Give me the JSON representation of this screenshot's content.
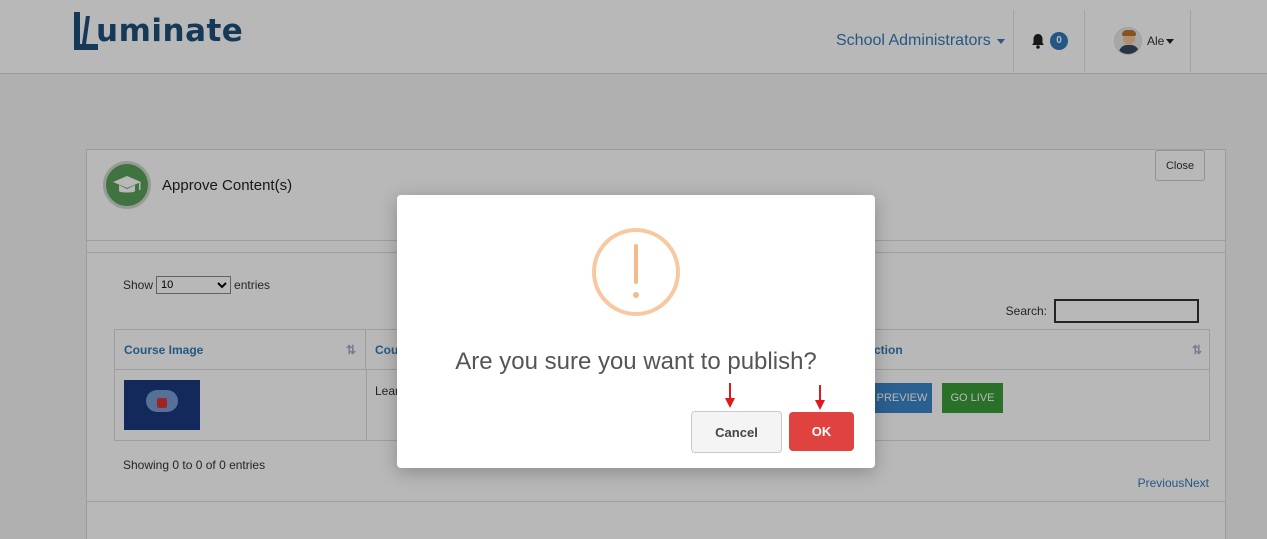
{
  "header": {
    "logo_text": "uminate",
    "role_menu_label": "School Administrators",
    "notification_count": "0",
    "user_name": "Ale"
  },
  "panel": {
    "title": "Approve Content(s)",
    "close_label": "Close",
    "show_label": "Show",
    "entries_label": "entries",
    "page_length_selected": "10",
    "search_label": "Search:",
    "search_value": "",
    "columns": [
      "Course Image",
      "Cour",
      "ction"
    ],
    "row": {
      "course_name_partial": "Lear",
      "preview_label": "PREVIEW",
      "golive_label": "GO LIVE"
    },
    "showing_text": "Showing 0 to 0 of 0 entries",
    "pager": {
      "previous": "Previous",
      "next": "Next"
    }
  },
  "modal": {
    "icon": "warning-icon",
    "question": "Are you sure you want to publish?",
    "cancel_label": "Cancel",
    "ok_label": "OK",
    "colors": {
      "ok": "#e0433f",
      "warning": "#f8c8a0",
      "annotation_arrow": "#e0191b"
    }
  }
}
